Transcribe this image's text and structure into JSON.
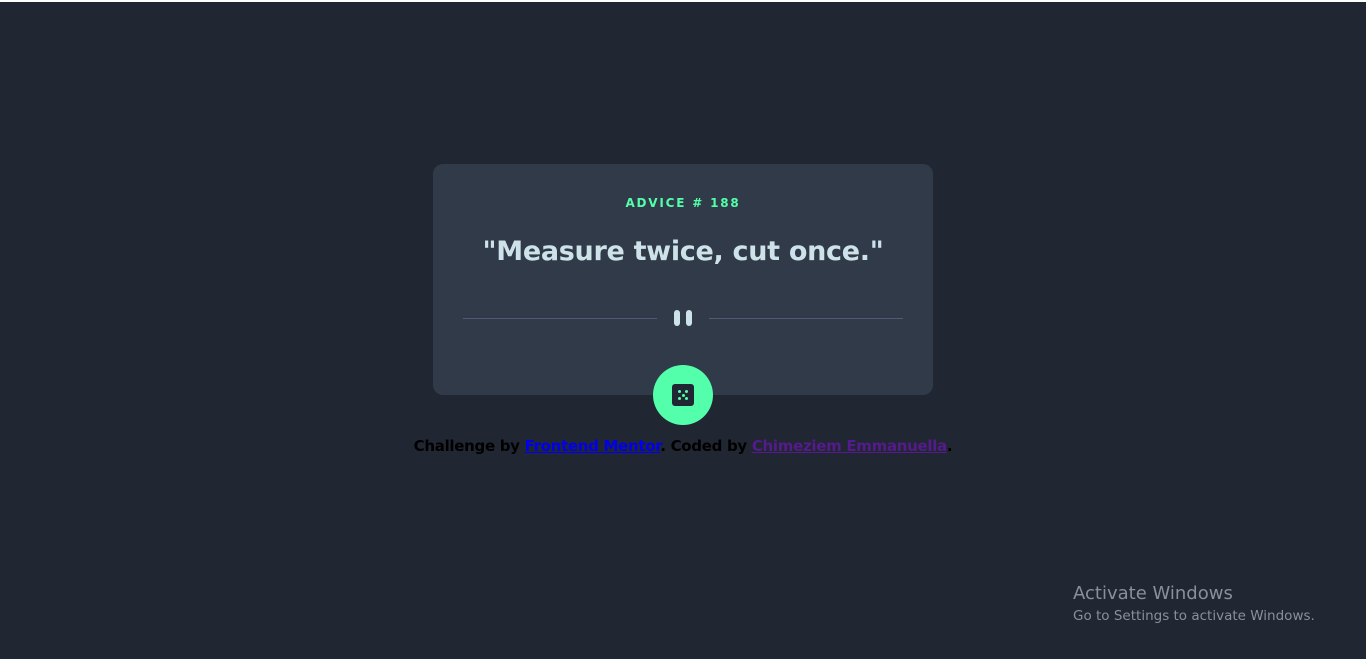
{
  "advice": {
    "label": "ADVICE # 188",
    "quote": "\"Measure twice, cut once.\""
  },
  "icons": {
    "divider": "pause-icon",
    "generate": "dice-icon"
  },
  "footer": {
    "prefix": "Challenge by ",
    "fm_link": "Frontend Mentor",
    "middle": ". Coded by ",
    "author_link": "Chimeziem Emmanuella",
    "suffix": "."
  },
  "watermark": {
    "title": "Activate Windows",
    "subtitle": "Go to Settings to activate Windows."
  },
  "colors": {
    "background": "#202632",
    "card": "#313a48",
    "accent": "#53ffaa",
    "quote_text": "#cee3e9",
    "divider": "#4f5d74"
  }
}
